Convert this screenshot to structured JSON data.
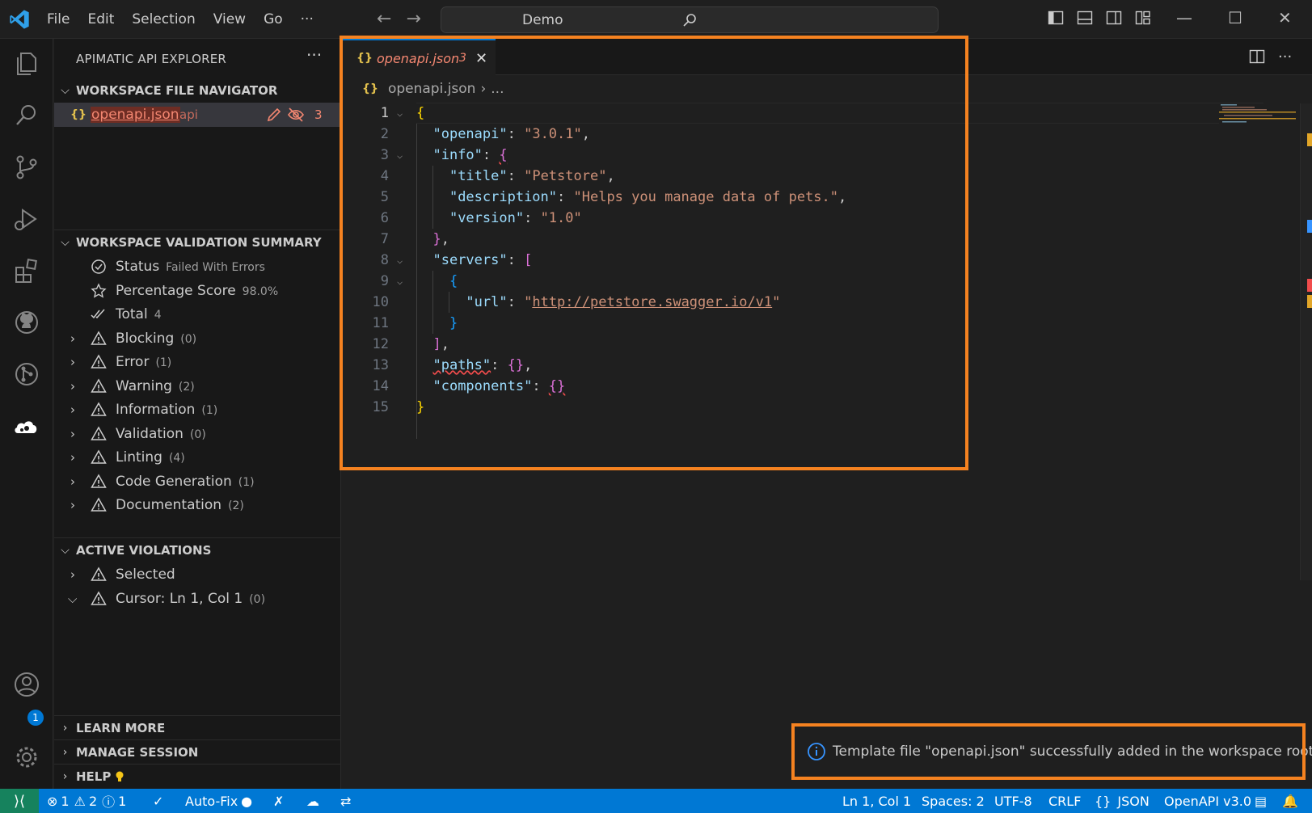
{
  "menu": [
    "File",
    "Edit",
    "Selection",
    "View",
    "Go",
    "···"
  ],
  "search": {
    "text": "Demo"
  },
  "sidebar": {
    "title": "APIMATIC API EXPLORER",
    "more": "···",
    "file_navigator": {
      "title": "WORKSPACE FILE NAVIGATOR",
      "file": {
        "icon": "{}",
        "name": "openapi.json",
        "folder": "api",
        "problems": "3"
      }
    },
    "validation_summary": {
      "title": "WORKSPACE VALIDATION SUMMARY",
      "status": {
        "label": "Status",
        "value": "Failed With Errors"
      },
      "score": {
        "label": "Percentage Score",
        "value": "98.0%"
      },
      "total": {
        "label": "Total",
        "value": "4"
      },
      "categories": [
        {
          "label": "Blocking",
          "count": "(0)"
        },
        {
          "label": "Error",
          "count": "(1)"
        },
        {
          "label": "Warning",
          "count": "(2)"
        },
        {
          "label": "Information",
          "count": "(1)"
        },
        {
          "label": "Validation",
          "count": "(0)"
        },
        {
          "label": "Linting",
          "count": "(4)"
        },
        {
          "label": "Code Generation",
          "count": "(1)"
        },
        {
          "label": "Documentation",
          "count": "(2)"
        }
      ]
    },
    "active_violations": {
      "title": "ACTIVE VIOLATIONS",
      "items": [
        {
          "label": "Selected",
          "count": ""
        },
        {
          "label": "Cursor: Ln 1, Col 1",
          "count": "(0)"
        }
      ]
    },
    "learn_more": "LEARN MORE",
    "manage_session": "MANAGE SESSION",
    "help": "HELP"
  },
  "editor": {
    "tab": {
      "icon": "{}",
      "name": "openapi.json",
      "problems": "3",
      "close": "✕"
    },
    "breadcrumb": {
      "icon": "{}",
      "file": "openapi.json",
      "sep": "›",
      "more": "..."
    },
    "lines": [
      "1",
      "2",
      "3",
      "4",
      "5",
      "6",
      "7",
      "8",
      "9",
      "10",
      "11",
      "12",
      "13",
      "14",
      "15"
    ],
    "code": {
      "openapi_key": "\"openapi\"",
      "openapi_val": "\"3.0.1\"",
      "info_key": "\"info\"",
      "title_key": "\"title\"",
      "title_val": "\"Petstore\"",
      "desc_key": "\"description\"",
      "desc_val": "\"Helps you manage data of pets.\"",
      "version_key": "\"version\"",
      "version_val": "\"1.0\"",
      "servers_key": "\"servers\"",
      "url_key": "\"url\"",
      "url_val": "http://petstore.swagger.io/v1",
      "paths_key": "\"paths\"",
      "components_key": "\"components\""
    }
  },
  "notification": {
    "text": "Template file \"openapi.json\" successfully added in the workspace root ..."
  },
  "statusbar": {
    "errors": "1",
    "warnings": "2",
    "infos": "1",
    "autofix": "Auto-Fix",
    "position": "Ln 1, Col 1",
    "spaces": "Spaces: 2",
    "encoding": "UTF-8",
    "eol": "CRLF",
    "language_icon": "{}",
    "language": "JSON",
    "openapi": "OpenAPI v3.0"
  },
  "activity": {
    "accounts_badge": "1"
  },
  "colors": {
    "accent": "#0078d4",
    "highlight": "#f58220",
    "error": "#f48771"
  }
}
